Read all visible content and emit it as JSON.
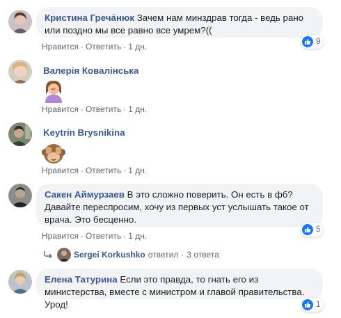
{
  "comments": [
    {
      "author": "Кристина Греча́нюк",
      "text": "Зачем нам минздрав тогда - ведь рано или поздно мы все равно все умрем?((",
      "like_label": "Нравится",
      "reply_label": "Ответить",
      "time": "1 дн.",
      "reaction_count": "9"
    },
    {
      "author": "Валерія Ковалінська",
      "like_label": "Нравится",
      "reply_label": "Ответить",
      "time": "1 дн.",
      "emoji": "facepalm-emoji"
    },
    {
      "author": "Keytrin Brysnikina",
      "like_label": "Нравится",
      "reply_label": "Ответить",
      "time": "1 дн.",
      "emoji": "see-no-evil-monkey-emoji"
    },
    {
      "author": "Сакен Аймурзаев",
      "text": "В это сложно поверить. Он есть в фб? Давайте переспросим, хочу из первых уст услышать такое от врача. Это бесценно.",
      "like_label": "Нравится",
      "reply_label": "Ответить",
      "time": "1 дн.",
      "reaction_count": "5",
      "replies": {
        "author": "Sergei Korkushko",
        "action": "ответил",
        "count": "3 ответа"
      }
    },
    {
      "author": "Елена Татурина",
      "text": "Если это правда, то гнать его из министерства, вместе с министром и главой правительства. Урод!",
      "like_label": "Нравится",
      "reply_label": "Ответить",
      "time": "1 дн.",
      "reaction_count": "1"
    }
  ],
  "colors": {
    "link": "#385898",
    "bubble": "#f2f3f5",
    "meta": "#606770",
    "like_blue": "#1877f2"
  }
}
